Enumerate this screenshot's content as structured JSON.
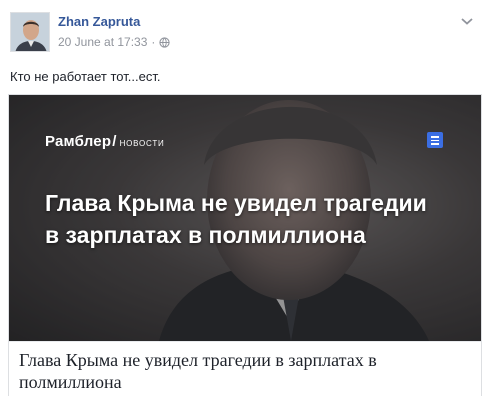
{
  "post": {
    "author": "Zhan Zapruta",
    "timestamp": "20 June at 17:33",
    "separator": "·",
    "privacy_icon": "globe-icon",
    "text": "Кто не работает тот...ест."
  },
  "link_card": {
    "brand": {
      "name": "Рамблер",
      "slash": "/",
      "section": "НОВОСТИ"
    },
    "image_headline": "Глава Крыма не увидел трагедии в зарплатах в полмиллиона",
    "title": "Глава Крыма не увидел трагедии в зарплатах в полмиллиона",
    "accent_color": "#3b6ee3"
  },
  "colors": {
    "author_link": "#365899",
    "meta_text": "#90949c"
  }
}
